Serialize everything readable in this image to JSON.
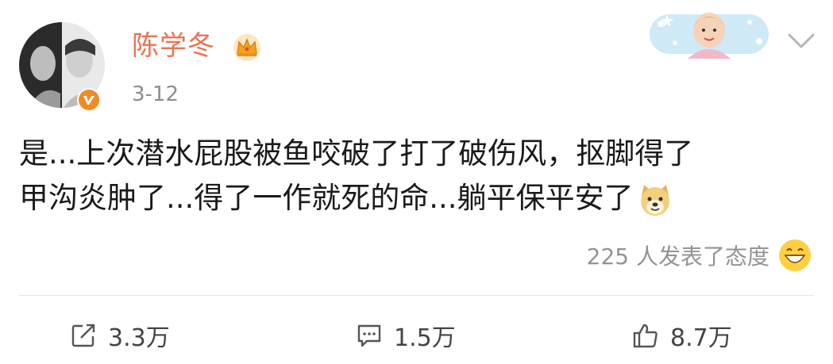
{
  "post": {
    "username": "陈学冬",
    "timestamp": "3-12",
    "text_line1": "是...上次潜水屁股被鱼咬破了打了破伤风，抠脚得了",
    "text_line2": "甲沟炎肿了...得了一作就死的命...躺平保平安了",
    "reactions_label": "225 人发表了态度"
  },
  "actions": {
    "repost_count": "3.3万",
    "comment_count": "1.5万",
    "like_count": "8.7万"
  },
  "colors": {
    "username": "#eb7350",
    "muted": "#8d8d8d",
    "badge": "#f08a24"
  },
  "icons": [
    "avatar",
    "verified-badge-icon",
    "crown-icon",
    "sticker-banner",
    "chevron-down-icon",
    "doge-emoji-icon",
    "grin-emoji-icon",
    "repost-icon",
    "comment-icon",
    "like-icon"
  ]
}
